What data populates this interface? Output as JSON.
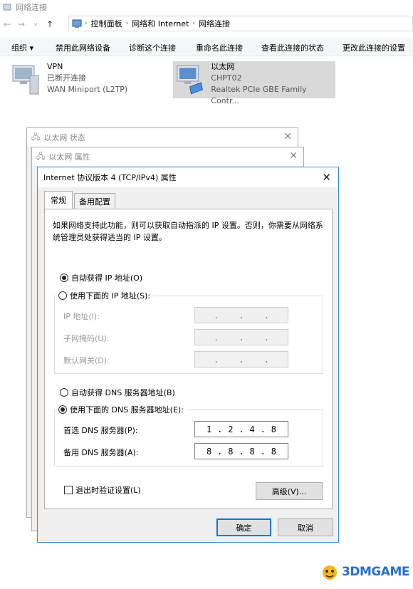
{
  "window": {
    "title": "网络连接"
  },
  "breadcrumb": [
    "控制面板",
    "网络和 Internet",
    "网络连接"
  ],
  "toolbar": {
    "organize": "组织 ▾",
    "disable": "禁用此网络设备",
    "diagnose": "诊断这个连接",
    "rename": "重命名此连接",
    "view_status": "查看此连接的状态",
    "change_settings": "更改此连接的设置"
  },
  "connections": [
    {
      "name": "VPN",
      "status": "已断开连接",
      "device": "WAN Miniport (L2TP)"
    },
    {
      "name": "以太网",
      "status": "CHPT02",
      "device": "Realtek PCIe GBE Family Contr..."
    }
  ],
  "dialogs": {
    "status_title": "以太网 状态",
    "props_title": "以太网 属性",
    "ipv4_title": "Internet 协议版本 4 (TCP/IPv4) 属性"
  },
  "tabs": {
    "general": "常规",
    "alternate": "备用配置"
  },
  "description": "如果网络支持此功能，则可以获取自动指派的 IP 设置。否则，你需要从网络系统管理员处获得适当的 IP 设置。",
  "ip": {
    "auto_label": "自动获得 IP 地址(O)",
    "manual_label": "使用下面的 IP 地址(S):",
    "address_label": "IP 地址(I):",
    "mask_label": "子网掩码(U):",
    "gateway_label": "默认网关(D):",
    "dot": "."
  },
  "dns": {
    "auto_label": "自动获得 DNS 服务器地址(B)",
    "manual_label": "使用下面的 DNS 服务器地址(E):",
    "preferred_label": "首选 DNS 服务器(P):",
    "alternate_label": "备用 DNS 服务器(A):",
    "preferred": [
      "1",
      "2",
      "4",
      "8"
    ],
    "alternate": [
      "8",
      "8",
      "8",
      "8"
    ]
  },
  "validate_label": "退出时验证设置(L)",
  "buttons": {
    "advanced": "高级(V)...",
    "ok": "确定",
    "cancel": "取消"
  },
  "watermark": "3DMGAME",
  "colors": {
    "accent": "#0078d7",
    "dialog_border": "#3c8dde",
    "watermark": "#2a6fc8"
  }
}
